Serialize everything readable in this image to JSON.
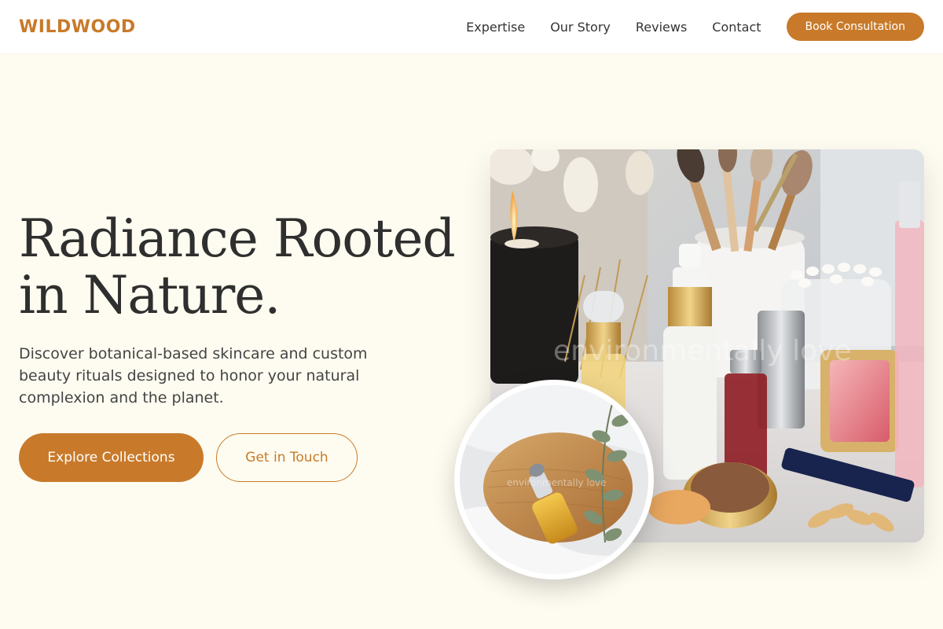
{
  "brand": {
    "logo": "WILDWOOD",
    "accent": "#c87a2a"
  },
  "nav": {
    "items": [
      "Expertise",
      "Our Story",
      "Reviews",
      "Contact"
    ],
    "cta": "Book Consultation"
  },
  "hero": {
    "title_line1": "Radiance Rooted",
    "title_line2": "in Nature.",
    "subtitle": "Discover botanical-based skincare and custom beauty rituals designed to honor your natural complexion and the planet.",
    "primary_button": "Explore Collections",
    "secondary_button": "Get in Touch"
  },
  "images": {
    "main_watermark": "environmentally love",
    "round_watermark": "environmentally love"
  },
  "icons": [
    "cosmetics-photo",
    "serum-photo"
  ]
}
